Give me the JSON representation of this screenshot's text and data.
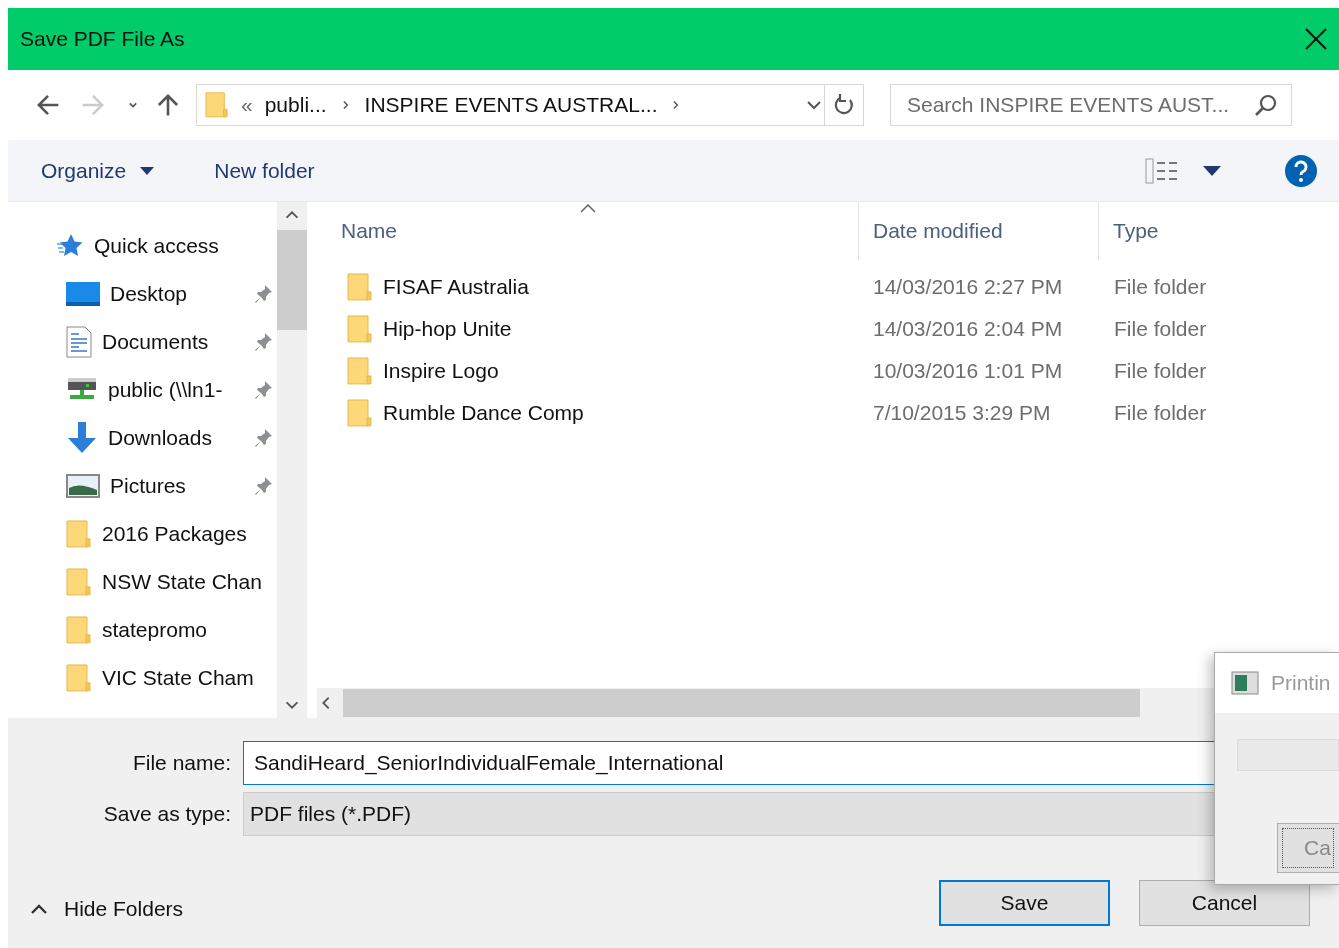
{
  "window": {
    "title": "Save PDF File As"
  },
  "address_bar": {
    "overflow": "«",
    "segments": [
      "publi...",
      "INSPIRE EVENTS AUSTRAL..."
    ]
  },
  "search": {
    "placeholder": "Search INSPIRE EVENTS AUST..."
  },
  "toolbar": {
    "organize": "Organize",
    "new_folder": "New folder"
  },
  "sidebar": {
    "items": [
      {
        "label": "Quick access",
        "kind": "quick",
        "pinned": false
      },
      {
        "label": "Desktop",
        "kind": "desktop",
        "pinned": true
      },
      {
        "label": "Documents",
        "kind": "documents",
        "pinned": true
      },
      {
        "label": "public (\\\\ln1-",
        "kind": "network",
        "pinned": true
      },
      {
        "label": "Downloads",
        "kind": "downloads",
        "pinned": true
      },
      {
        "label": "Pictures",
        "kind": "pictures",
        "pinned": true
      },
      {
        "label": "2016 Packages",
        "kind": "folder",
        "pinned": false
      },
      {
        "label": "NSW State Chan",
        "kind": "folder",
        "pinned": false
      },
      {
        "label": "statepromo",
        "kind": "folder",
        "pinned": false
      },
      {
        "label": "VIC State Cham",
        "kind": "folder",
        "pinned": false
      }
    ]
  },
  "columns": [
    {
      "label": "Name",
      "sorted": true
    },
    {
      "label": "Date modified",
      "sorted": false
    },
    {
      "label": "Type",
      "sorted": false
    }
  ],
  "rows": [
    {
      "name": "FISAF Australia",
      "date": "14/03/2016 2:27 PM",
      "type": "File folder"
    },
    {
      "name": "Hip-hop Unite",
      "date": "14/03/2016 2:04 PM",
      "type": "File folder"
    },
    {
      "name": "Inspire Logo",
      "date": "10/03/2016 1:01 PM",
      "type": "File folder"
    },
    {
      "name": "Rumble Dance Comp",
      "date": "7/10/2015 3:29 PM",
      "type": "File folder"
    }
  ],
  "file_name": {
    "label": "File name:",
    "value": "SandiHeard_SeniorIndividualFemale_International"
  },
  "save_as_type": {
    "label": "Save as type:",
    "value": "PDF files (*.PDF)"
  },
  "hide_folders": "Hide Folders",
  "buttons": [
    {
      "label": "Save",
      "default": true
    },
    {
      "label": "Cancel",
      "default": false
    }
  ],
  "printing_dialog": {
    "title": "Printin",
    "button": "Ca"
  }
}
